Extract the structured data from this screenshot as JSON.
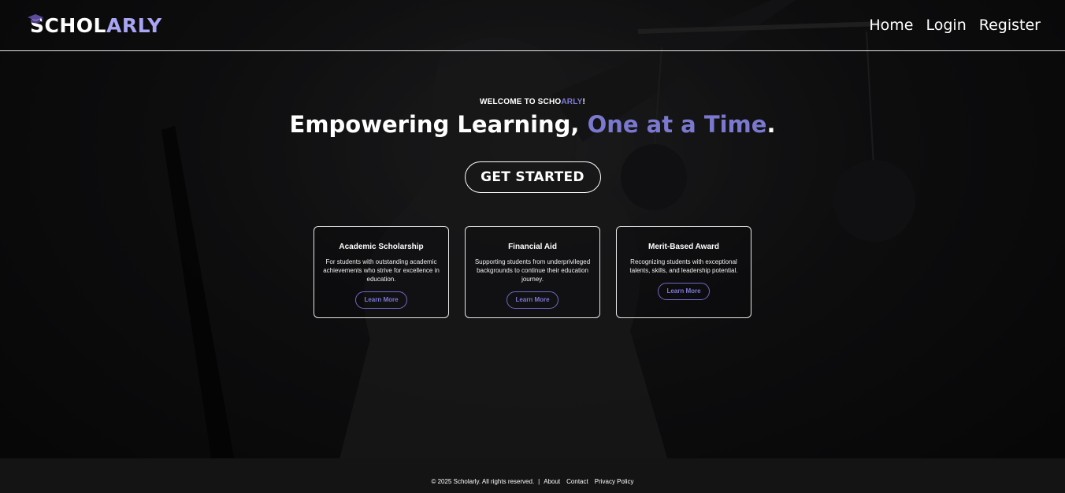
{
  "brand": {
    "part1": "SCHOL",
    "part2": "ARLY"
  },
  "nav": {
    "items": [
      {
        "label": "Home"
      },
      {
        "label": "Login"
      },
      {
        "label": "Register"
      }
    ]
  },
  "hero": {
    "welcome_prefix": "WELCOME TO SCHO",
    "welcome_accent": "ARLY",
    "welcome_suffix": "!",
    "headline_main": "Empowering Learning, ",
    "headline_accent": "One at a Time",
    "headline_end": ".",
    "cta_label": "GET STARTED"
  },
  "cards": [
    {
      "title": "Academic Scholarship",
      "description": "For students with outstanding academic achievements who strive for excellence in education.",
      "button": "Learn More"
    },
    {
      "title": "Financial Aid",
      "description": "Supporting students from underprivileged backgrounds to continue their education journey.",
      "button": "Learn More"
    },
    {
      "title": "Merit-Based Award",
      "description": "Recognizing students with exceptional talents, skills, and leadership potential.",
      "button": "Learn More"
    }
  ],
  "footer": {
    "copyright": "© 2025 Scholarly. All rights reserved.",
    "separator": "|",
    "links": [
      {
        "label": "About"
      },
      {
        "label": "Contact"
      },
      {
        "label": "Privacy Policy"
      }
    ]
  },
  "colors": {
    "accent": "#7b78cf",
    "background": "#0d0d0f",
    "footer_bg": "#141414"
  },
  "icons": {
    "logo_icon": "graduation-cap-icon"
  }
}
